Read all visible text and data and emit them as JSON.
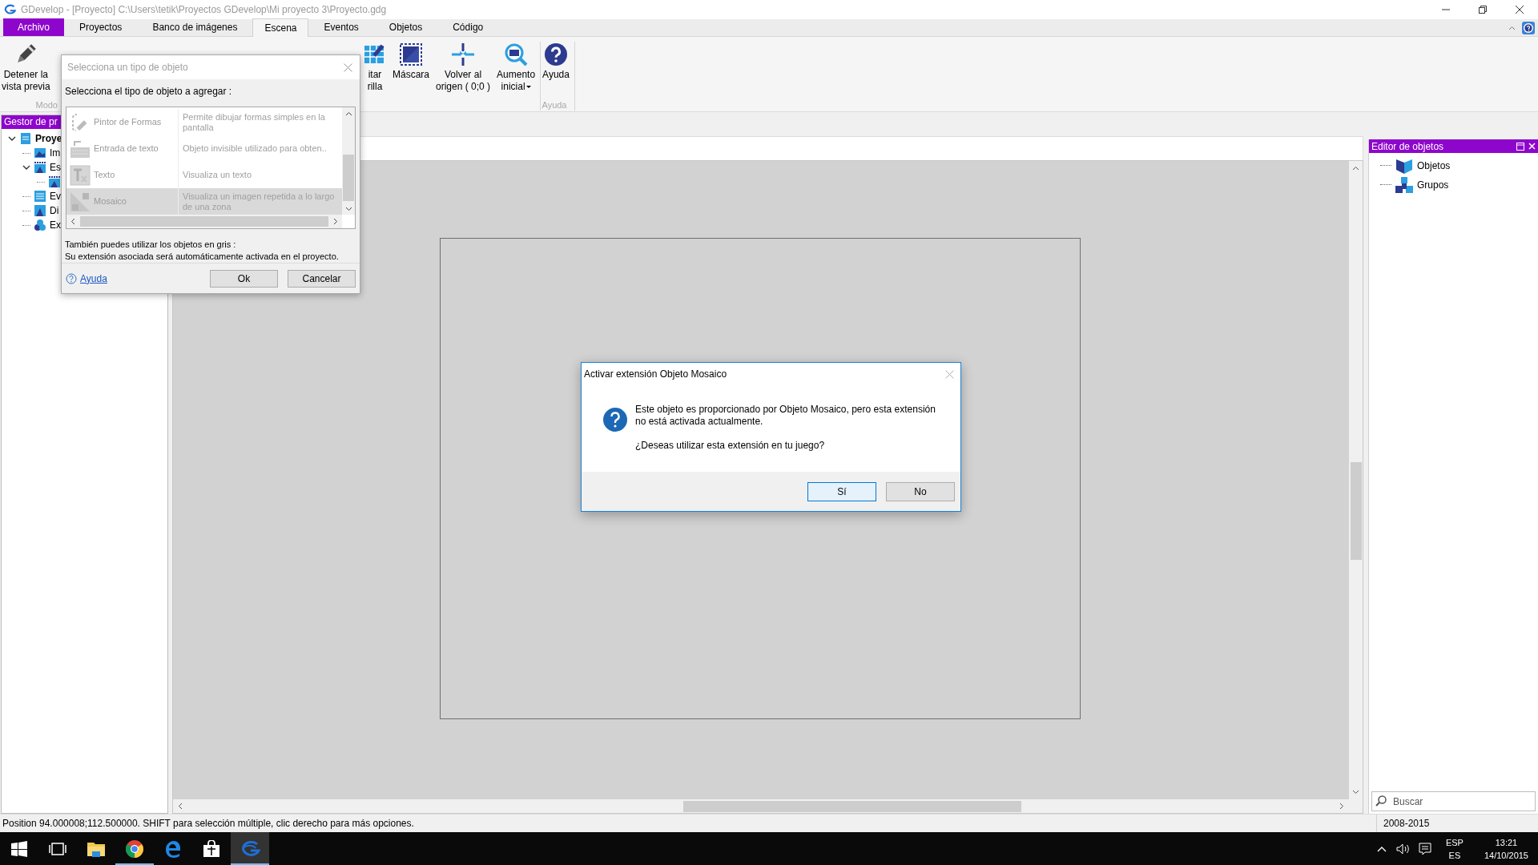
{
  "window": {
    "title": "GDevelop - [Proyecto] C:\\Users\\tetik\\Proyectos GDevelop\\Mi proyecto 3\\Proyecto.gdg"
  },
  "menu_tabs": [
    {
      "label": "Archivo",
      "kind": "file",
      "selected": false
    },
    {
      "label": "Proyectos",
      "kind": "tab",
      "selected": false
    },
    {
      "label": "Banco de imágenes",
      "kind": "tab",
      "selected": false
    },
    {
      "label": "Escena",
      "kind": "tab",
      "selected": true
    },
    {
      "label": "Eventos",
      "kind": "tab",
      "selected": false
    },
    {
      "label": "Objetos",
      "kind": "tab",
      "selected": false
    },
    {
      "label": "Código",
      "kind": "tab",
      "selected": false
    }
  ],
  "ribbon_groups": [
    {
      "label": "Modo",
      "items": [
        {
          "kind": "pencil",
          "lines": [
            "Detener la",
            "vista previa"
          ]
        }
      ]
    },
    {
      "items": [
        {
          "kind": "grid-edit",
          "lines": [
            "itar",
            "rilla"
          ]
        },
        {
          "kind": "mask",
          "lines": [
            "Máscara"
          ]
        },
        {
          "kind": "origin",
          "lines": [
            "Volver al",
            "origen ( 0;0 )"
          ]
        },
        {
          "kind": "zoom",
          "lines": [
            "Aumento",
            "inicial"
          ],
          "dropdown": true
        }
      ]
    },
    {
      "label": "Ayuda",
      "items": [
        {
          "kind": "help",
          "lines": [
            "Ayuda"
          ]
        }
      ]
    }
  ],
  "project_manager": {
    "title": "Gestor de pr",
    "tree": [
      {
        "label": "Proye",
        "kind": "project",
        "expanded": true,
        "children": [
          {
            "label": "Im",
            "kind": "images"
          },
          {
            "label": "Es",
            "kind": "scenes",
            "expanded": true,
            "children": [
              {
                "kind": "scene"
              }
            ]
          },
          {
            "label": "Ev",
            "kind": "events"
          },
          {
            "label": "Di",
            "kind": "layouts"
          },
          {
            "label": "Ex",
            "kind": "extensions"
          }
        ]
      }
    ]
  },
  "object_editor": {
    "title": "Editor de objetos",
    "tree": [
      {
        "label": "Objetos",
        "kind": "objects"
      },
      {
        "label": "Grupos",
        "kind": "groups"
      }
    ],
    "search": {
      "placeholder": "Buscar"
    }
  },
  "object_type_dialog": {
    "title": "Selecciona un tipo de objeto",
    "prompt": "Selecciona el tipo de objeto a agregar :",
    "items": [
      {
        "kind": "shape-painter",
        "name": "Pintor de Formas",
        "description": "Permite dibujar formas simples en la pantalla",
        "selected": false
      },
      {
        "kind": "text-entry",
        "name": "Entrada de texto",
        "description": "Objeto invisible utilizado para obten..",
        "selected": false
      },
      {
        "kind": "text",
        "name": "Texto",
        "description": "Visualiza un texto",
        "selected": false
      },
      {
        "kind": "tiled",
        "name": "Mosaico",
        "description": "Visualiza un imagen repetida a lo largo de una zona",
        "selected": true
      }
    ],
    "note_lines": [
      "También puedes utilizar los objetos en gris :",
      "Su extensión asociada será automáticamente activada en el proyecto."
    ],
    "help_link": "Ayuda",
    "buttons": [
      "Ok",
      "Cancelar"
    ]
  },
  "extension_dialog": {
    "title": "Activar extensión Objeto Mosaico",
    "message": "Este objeto es proporcionado por Objeto Mosaico, pero esta extensión no está activada actualmente.",
    "question": "¿Deseas utilizar esta extensión en tu juego?",
    "buttons": [
      {
        "label": "Sí",
        "selected": true
      },
      {
        "label": "No",
        "selected": false
      }
    ]
  },
  "status_bar": {
    "text": "Position 94.000008;112.500000. SHIFT para selección múltiple, clic derecho para más opciones.",
    "copyright": "2008-2015"
  },
  "taskbar": {
    "apps": [
      {
        "kind": "start",
        "running": false,
        "selected": false
      },
      {
        "kind": "task-view",
        "running": false,
        "selected": false
      },
      {
        "kind": "explorer",
        "running": false,
        "selected": false
      },
      {
        "kind": "chrome",
        "running": true,
        "selected": false
      },
      {
        "kind": "edge",
        "running": false,
        "selected": false
      },
      {
        "kind": "store",
        "running": false,
        "selected": false
      },
      {
        "kind": "gdevelop",
        "running": true,
        "selected": true
      }
    ],
    "language": [
      "ESP",
      "ES"
    ],
    "time": "13:21",
    "date": "14/10/2015"
  }
}
